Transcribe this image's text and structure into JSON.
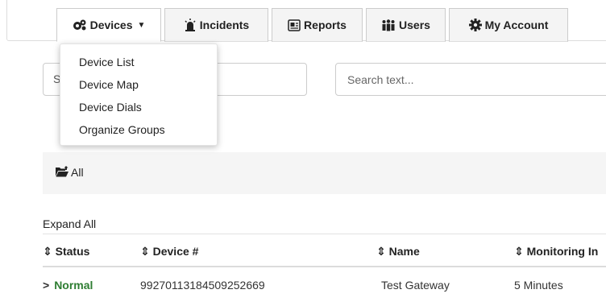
{
  "nav": {
    "tabs": [
      {
        "label": "Devices",
        "icon": "devices-icon"
      },
      {
        "label": "Incidents",
        "icon": "alarm-icon"
      },
      {
        "label": "Reports",
        "icon": "report-icon"
      },
      {
        "label": "Users",
        "icon": "users-icon"
      },
      {
        "label": "My Account",
        "icon": "gear-icon"
      }
    ],
    "devices_menu": [
      "Device List",
      "Device Map",
      "Device Dials",
      "Organize Groups"
    ]
  },
  "search": {
    "left_visible_char": "S",
    "right_placeholder": "Search text..."
  },
  "groups": {
    "all_label": "All"
  },
  "table": {
    "expand_all": "Expand All",
    "headers": [
      "Status",
      "Device #",
      "Name",
      "Monitoring In"
    ],
    "rows": [
      {
        "status": "Normal",
        "device": "99270113184509252669",
        "name": "Test Gateway",
        "monitoring": "5 Minutes"
      }
    ]
  },
  "colors": {
    "status_normal": "#2e7d32",
    "group_bar_bg": "#f5f5f5"
  }
}
